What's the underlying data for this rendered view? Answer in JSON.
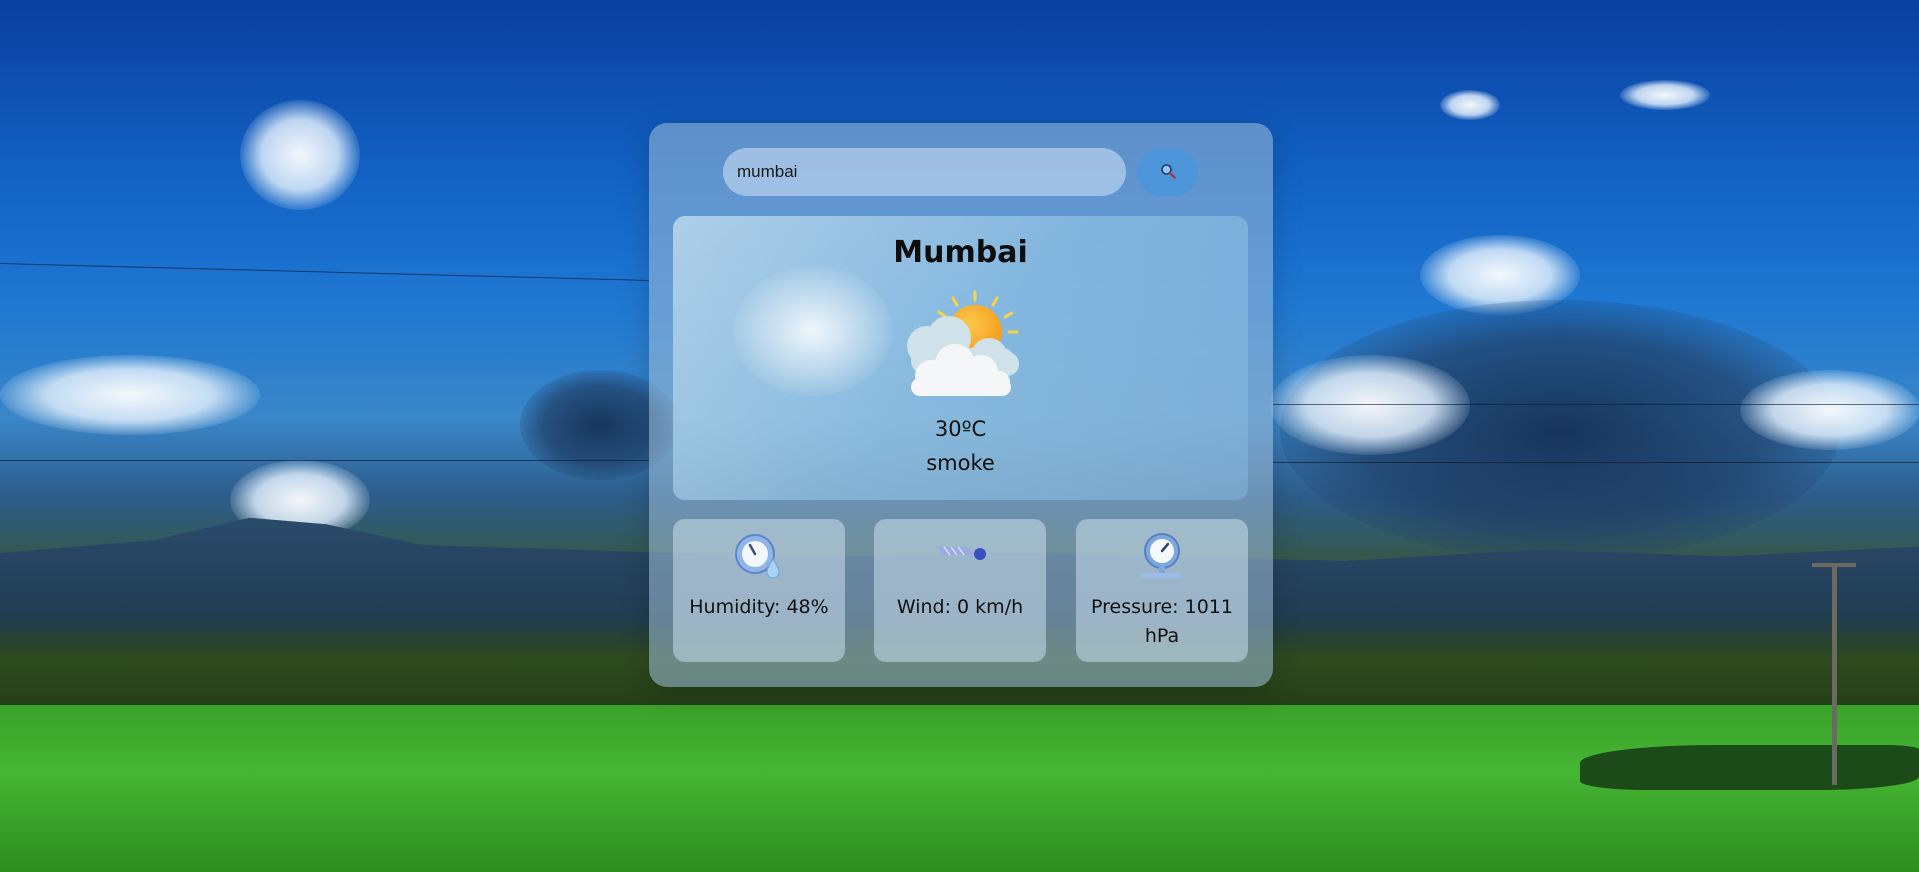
{
  "search": {
    "value": "mumbai",
    "button_icon": "search-icon"
  },
  "weather": {
    "city": "Mumbai",
    "temperature": "30ºC",
    "description": "smoke",
    "icon": "sun-behind-cloud-icon"
  },
  "stats": {
    "humidity": {
      "label": "Humidity: 48%",
      "icon": "humidity-gauge-icon"
    },
    "wind": {
      "label": "Wind: 0 km/h",
      "icon": "wind-icon"
    },
    "pressure": {
      "label": "Pressure: 1011 hPa",
      "icon": "pressure-gauge-icon"
    }
  },
  "colors": {
    "sun": "#f6a623",
    "search_button": "#4696dc",
    "wind_dot": "#3b4fc4"
  }
}
